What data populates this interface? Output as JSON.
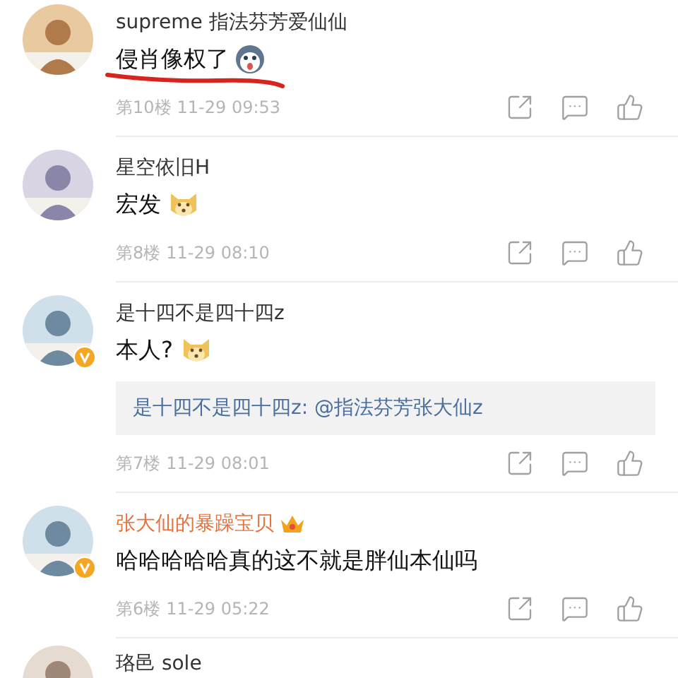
{
  "comments": [
    {
      "name": "supreme 指法芬芳爱仙仙",
      "vip": false,
      "text": "侵肖像权了",
      "emoji": {
        "kind": "husky"
      },
      "underlined": true,
      "floor": "第10楼",
      "time": "11-29 09:53"
    },
    {
      "name": "星空依旧H",
      "vip": false,
      "text": "宏发",
      "emoji": {
        "kind": "doge"
      },
      "floor": "第8楼",
      "time": "11-29 08:10"
    },
    {
      "name": "是十四不是四十四z",
      "vip": false,
      "verified": true,
      "text": "本人?",
      "emoji": {
        "kind": "doge"
      },
      "reply": "是十四不是四十四z: @指法芬芳张大仙z",
      "floor": "第7楼",
      "time": "11-29 08:01"
    },
    {
      "name": "张大仙的暴躁宝贝",
      "vip": true,
      "crown": true,
      "verified": true,
      "text": "哈哈哈哈哈真的这不就是胖仙本仙吗",
      "floor": "第6楼",
      "time": "11-29 05:22"
    },
    {
      "name": "珞邑 sole",
      "vip": false,
      "partial": true
    }
  ]
}
